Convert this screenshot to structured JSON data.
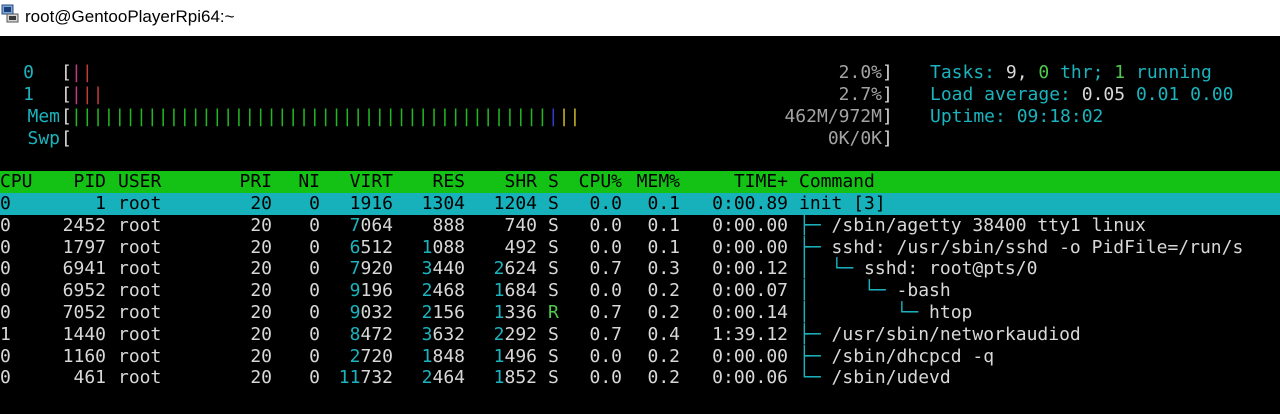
{
  "window": {
    "title": "root@GentooPlayerRpi64:~",
    "icon": "terminal-icon"
  },
  "meters": [
    {
      "label": "0",
      "value_text": "2.0%",
      "bars": [
        {
          "text": "|",
          "color": "#c03a8c"
        },
        {
          "text": "|",
          "color": "#c03a3a"
        }
      ]
    },
    {
      "label": "1",
      "value_text": "2.7%",
      "bars": [
        {
          "text": "|",
          "color": "#c03a8c"
        },
        {
          "text": "||",
          "color": "#c03a3a"
        }
      ]
    },
    {
      "label": "Mem",
      "value_text": "462M/972M",
      "bars": [
        {
          "text": "||||||||||||||||||||||||||||||||||||||||||||",
          "color": "#22b822"
        },
        {
          "text": "|",
          "color": "#2f3fc9"
        },
        {
          "text": "||",
          "color": "#c8b628"
        }
      ]
    },
    {
      "label": "Swp",
      "value_text": "0K/0K",
      "bars": []
    }
  ],
  "summary": {
    "tasks_label": "Tasks:",
    "tasks": "9,",
    "thr": "0",
    "thr_label": "thr;",
    "running": "1",
    "running_label": "running",
    "load_label": "Load average:",
    "load1": "0.05",
    "load5": "0.01",
    "load15": "0.00",
    "uptime_label": "Uptime:",
    "uptime": "09:18:02"
  },
  "table": {
    "columns": [
      "CPU",
      "PID",
      "USER",
      "PRI",
      "NI",
      "VIRT",
      "RES",
      "SHR",
      "S",
      "CPU%",
      "MEM%",
      "TIME+",
      "Command"
    ],
    "rows": [
      {
        "cpu": "0",
        "pid": "1",
        "user": "root",
        "pri": "20",
        "ni": "0",
        "virt": "1916",
        "res": "1304",
        "shr": "1204",
        "s": "S",
        "cpup": "0.0",
        "memp": "0.1",
        "time": "0:00.89",
        "tree": "",
        "command": "init [3]"
      },
      {
        "cpu": "0",
        "pid": "2452",
        "user": "root",
        "pri": "20",
        "ni": "0",
        "virt": "7064",
        "res": "888",
        "shr": "740",
        "s": "S",
        "cpup": "0.0",
        "memp": "0.1",
        "time": "0:00.00",
        "tree": "├─ ",
        "command": "/sbin/agetty 38400 tty1 linux"
      },
      {
        "cpu": "0",
        "pid": "1797",
        "user": "root",
        "pri": "20",
        "ni": "0",
        "virt": "6512",
        "res": "1088",
        "shr": "492",
        "s": "S",
        "cpup": "0.0",
        "memp": "0.1",
        "time": "0:00.00",
        "tree": "├─ ",
        "command": "sshd: /usr/sbin/sshd -o PidFile=/run/s"
      },
      {
        "cpu": "0",
        "pid": "6941",
        "user": "root",
        "pri": "20",
        "ni": "0",
        "virt": "7920",
        "res": "3440",
        "shr": "2624",
        "s": "S",
        "cpup": "0.7",
        "memp": "0.3",
        "time": "0:00.12",
        "tree": "│  └─ ",
        "command": "sshd: root@pts/0"
      },
      {
        "cpu": "0",
        "pid": "6952",
        "user": "root",
        "pri": "20",
        "ni": "0",
        "virt": "9196",
        "res": "2468",
        "shr": "1684",
        "s": "S",
        "cpup": "0.0",
        "memp": "0.2",
        "time": "0:00.07",
        "tree": "│     └─ ",
        "command": "-bash"
      },
      {
        "cpu": "0",
        "pid": "7052",
        "user": "root",
        "pri": "20",
        "ni": "0",
        "virt": "9032",
        "res": "2156",
        "shr": "1336",
        "s": "R",
        "cpup": "0.7",
        "memp": "0.2",
        "time": "0:00.14",
        "tree": "│        └─ ",
        "command": "htop"
      },
      {
        "cpu": "1",
        "pid": "1440",
        "user": "root",
        "pri": "20",
        "ni": "0",
        "virt": "8472",
        "res": "3632",
        "shr": "2292",
        "s": "S",
        "cpup": "0.7",
        "memp": "0.4",
        "time": "1:39.12",
        "tree": "├─ ",
        "command": "/usr/sbin/networkaudiod"
      },
      {
        "cpu": "0",
        "pid": "1160",
        "user": "root",
        "pri": "20",
        "ni": "0",
        "virt": "2720",
        "res": "1848",
        "shr": "1496",
        "s": "S",
        "cpup": "0.0",
        "memp": "0.2",
        "time": "0:00.00",
        "tree": "├─ ",
        "command": "/sbin/dhcpcd -q"
      },
      {
        "cpu": "0",
        "pid": "461",
        "user": "root",
        "pri": "20",
        "ni": "0",
        "virt": "11732",
        "res": "2464",
        "shr": "1852",
        "s": "S",
        "cpup": "0.0",
        "memp": "0.2",
        "time": "0:00.06",
        "tree": "└─ ",
        "command": "/sbin/udevd"
      }
    ]
  },
  "colors": {
    "cyan": "#1bb3bd",
    "white": "#d8d8d8",
    "header_bg": "#13c214",
    "selected_bg": "#17b1bb"
  }
}
